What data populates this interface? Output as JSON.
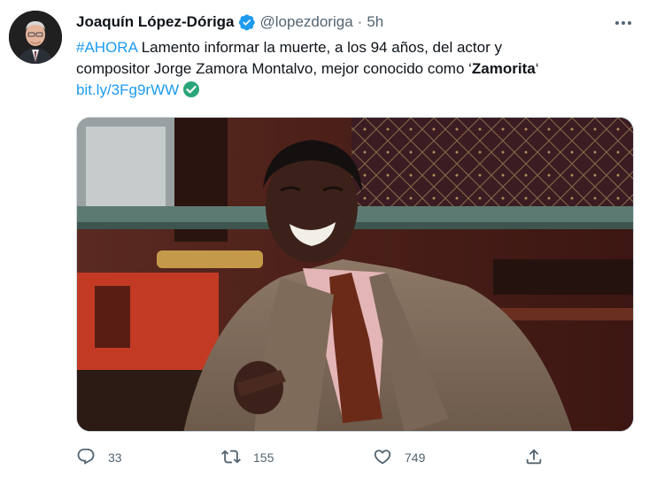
{
  "author": {
    "display_name": "Joaquín López-Dóriga",
    "handle": "@lopezdoriga",
    "separator": "·",
    "time": "5h",
    "avatar_icon": "profile-photo",
    "verified_icon": "verified-badge-icon"
  },
  "tweet": {
    "hashtag": "#AHORA",
    "line1_rest": " Lamento informar la muerte, a los 94 años, del actor y",
    "line2_start": "compositor Jorge Zamora Montalvo, mejor conocido como ‘",
    "line2_bold": "Zamorita",
    "line2_end": "‘",
    "link": "bit.ly/3Fg9rWW",
    "link_badge_icon": "check-circle-icon"
  },
  "media": {
    "type": "photo"
  },
  "actions": {
    "reply_count": "33",
    "retweet_count": "155",
    "like_count": "749"
  },
  "colors": {
    "link": "#1d9bf0",
    "secondary_text": "#536471",
    "verified": "#1d9bf0",
    "link_badge": "#2aa57a"
  }
}
